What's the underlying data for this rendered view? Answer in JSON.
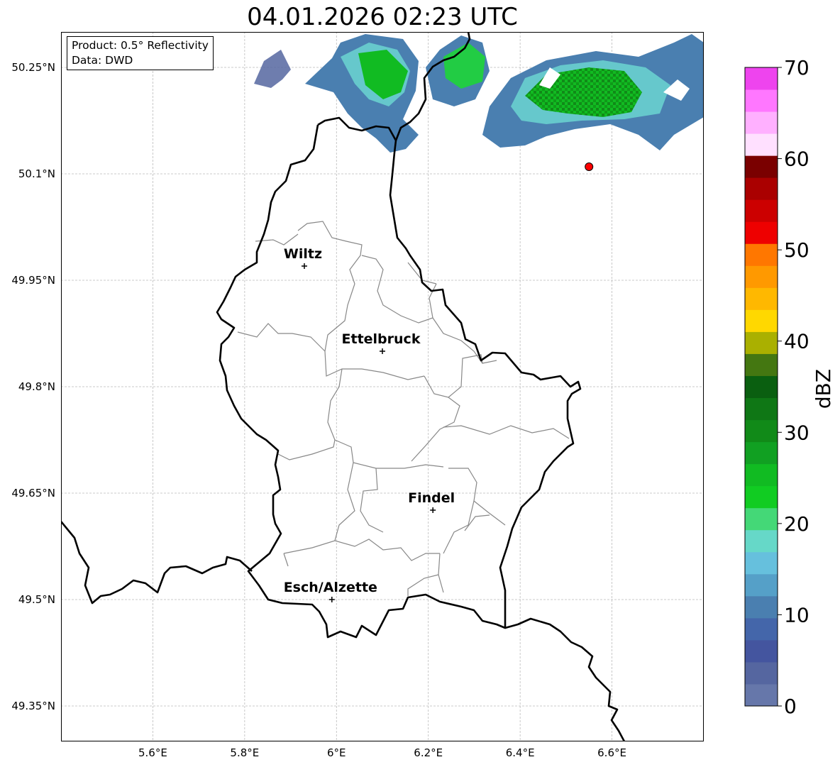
{
  "title": "04.01.2026 02:23 UTC",
  "info_box": {
    "product": "Product: 0.5° Reflectivity",
    "data_source": "Data: DWD"
  },
  "axes": {
    "lon_ticks": [
      "5.6°E",
      "5.8°E",
      "6°E",
      "6.2°E",
      "6.4°E",
      "6.6°E"
    ],
    "lat_ticks": [
      "50.25°N",
      "50.1°N",
      "49.95°N",
      "49.8°N",
      "49.65°N",
      "49.5°N",
      "49.35°N"
    ]
  },
  "cities": [
    {
      "name": "Wiltz",
      "lon": 5.93,
      "lat": 49.97
    },
    {
      "name": "Ettelbruck",
      "lon": 6.1,
      "lat": 49.85
    },
    {
      "name": "Findel",
      "lon": 6.21,
      "lat": 49.626
    },
    {
      "name": "Esch/Alzette",
      "lon": 5.99,
      "lat": 49.5
    }
  ],
  "marker": {
    "lon": 6.55,
    "lat": 50.11,
    "color": "#ff0000"
  },
  "colorbar": {
    "label": "dBZ",
    "ticks": [
      "0",
      "10",
      "20",
      "30",
      "40",
      "50",
      "60",
      "70"
    ],
    "colors": [
      "#6677aa",
      "#5566a0",
      "#44559f",
      "#4466aa",
      "#4a7fb0",
      "#55a0c8",
      "#66c0dd",
      "#66d8c8",
      "#44d877",
      "#11cc22",
      "#11bb22",
      "#11a022",
      "#118a18",
      "#0f7715",
      "#0a5f10",
      "#447711",
      "#aab000",
      "#ffd800",
      "#ffb800",
      "#ff9900",
      "#ff7700",
      "#ee0000",
      "#cc0000",
      "#aa0000",
      "#7a0000",
      "#ffe0ff",
      "#ffb0ff",
      "#ff77ff",
      "#ee44ee"
    ]
  }
}
